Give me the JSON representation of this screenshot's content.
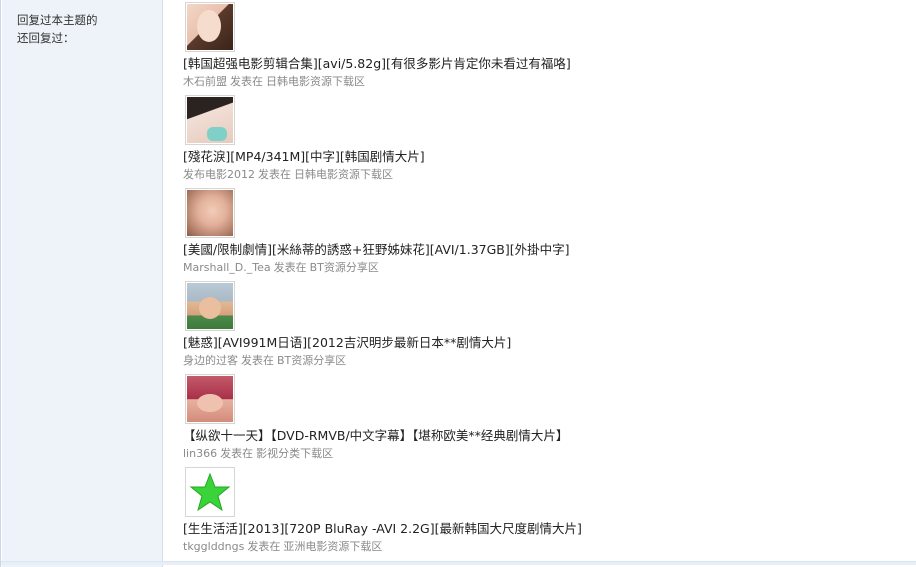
{
  "sidebar": {
    "label": "回复过本主题的还回复过："
  },
  "replies": [
    {
      "avatar": "avatar-girl-1",
      "title": "[韩国超强电影剪辑合集][avi/5.82g][有很多影片肯定你未看过有福咯]",
      "author": "木石前盟",
      "posted_in": "发表在",
      "forum": "日韩电影资源下载区"
    },
    {
      "avatar": "avatar-girl-2",
      "title": "[殘花淚][MP4/341M][中字][韩国剧情大片]",
      "author": "发布电影2012",
      "posted_in": "发表在",
      "forum": "日韩电影资源下载区"
    },
    {
      "avatar": "avatar-girl-3",
      "title": "[美國/限制劇情][米絲蒂的誘惑+狂野姊妹花][AVI/1.37GB][外掛中字]",
      "author": "Marshall_D._Tea",
      "posted_in": "发表在",
      "forum": "BT资源分享区"
    },
    {
      "avatar": "avatar-baby",
      "title": "[魅惑][AVI991M日语][2012吉沢明步最新日本**剧情大片]",
      "author": "身边的过客",
      "posted_in": "发表在",
      "forum": "BT资源分享区"
    },
    {
      "avatar": "avatar-girl-4",
      "title": "【纵欲十一天】【DVD-RMVB/中文字幕】【堪称欧美**经典剧情大片】",
      "author": "lin366",
      "posted_in": "发表在",
      "forum": "影视分类下载区"
    },
    {
      "avatar": "star-icon",
      "title": "[生生活活][2013][720P BluRay -AVI 2.2G][最新韩国大尺度剧情大片]",
      "author": "tkgglddngs",
      "posted_in": "发表在",
      "forum": "亚洲电影资源下载区"
    }
  ],
  "colors": {
    "sidebar_bg": "#edf3f9",
    "meta_text": "#8a8a8a",
    "star_green": "#3ad43a"
  }
}
